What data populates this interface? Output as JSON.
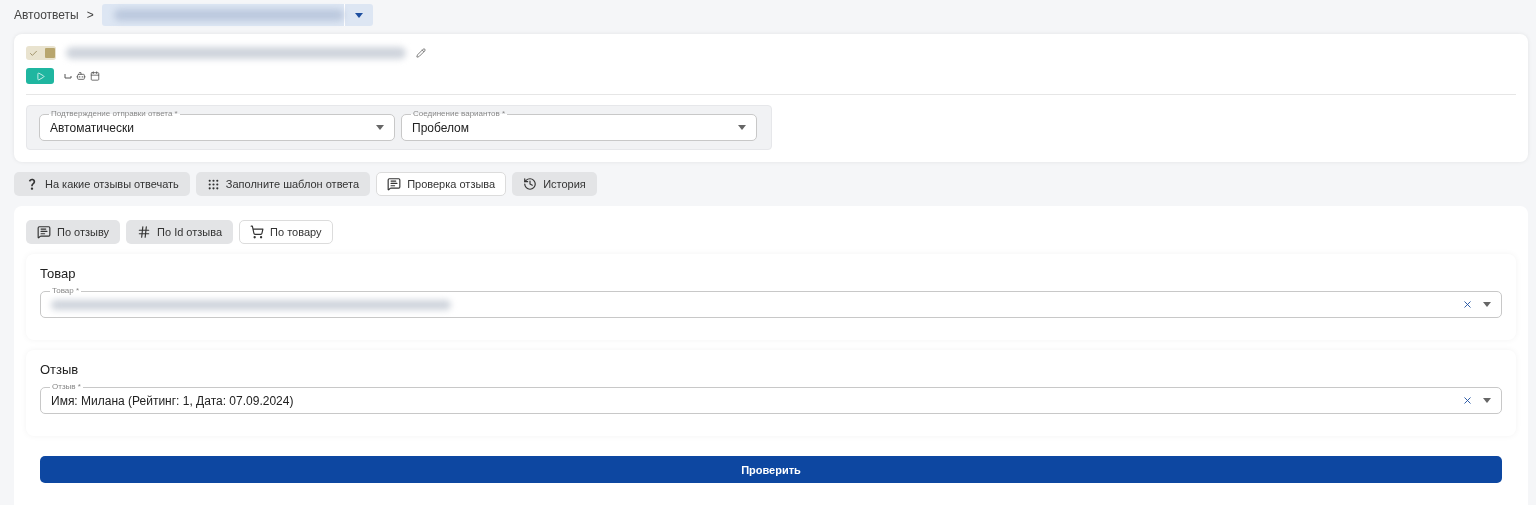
{
  "breadcrumb": {
    "root": "Автоответы",
    "separator": ">"
  },
  "rule": {
    "enabled": true
  },
  "settings": [
    {
      "label": "Подтверждение отправки ответа *",
      "value": "Автоматически"
    },
    {
      "label": "Соединение вариантов *",
      "value": "Пробелом"
    }
  ],
  "action_tabs": [
    {
      "kind": "help",
      "label": "На какие отзывы отвечать",
      "selected": false
    },
    {
      "kind": "template",
      "label": "Заполните шаблон ответа",
      "selected": false
    },
    {
      "kind": "review",
      "label": "Проверка отзыва",
      "selected": true
    },
    {
      "kind": "history",
      "label": "История",
      "selected": false
    }
  ],
  "mode_tabs": [
    {
      "kind": "review",
      "label": "По отзыву",
      "selected": false
    },
    {
      "kind": "id",
      "label": "По Id отзыва",
      "selected": false
    },
    {
      "kind": "product",
      "label": "По товару",
      "selected": true
    }
  ],
  "sections": [
    {
      "title": "Товар",
      "field_label": "Товар *"
    },
    {
      "title": "Отзыв",
      "field_label": "Отзыв *",
      "value": "Имя: Милана (Рейтинг: 1, Дата: 07.09.2024)"
    }
  ],
  "submit": "Проверить"
}
